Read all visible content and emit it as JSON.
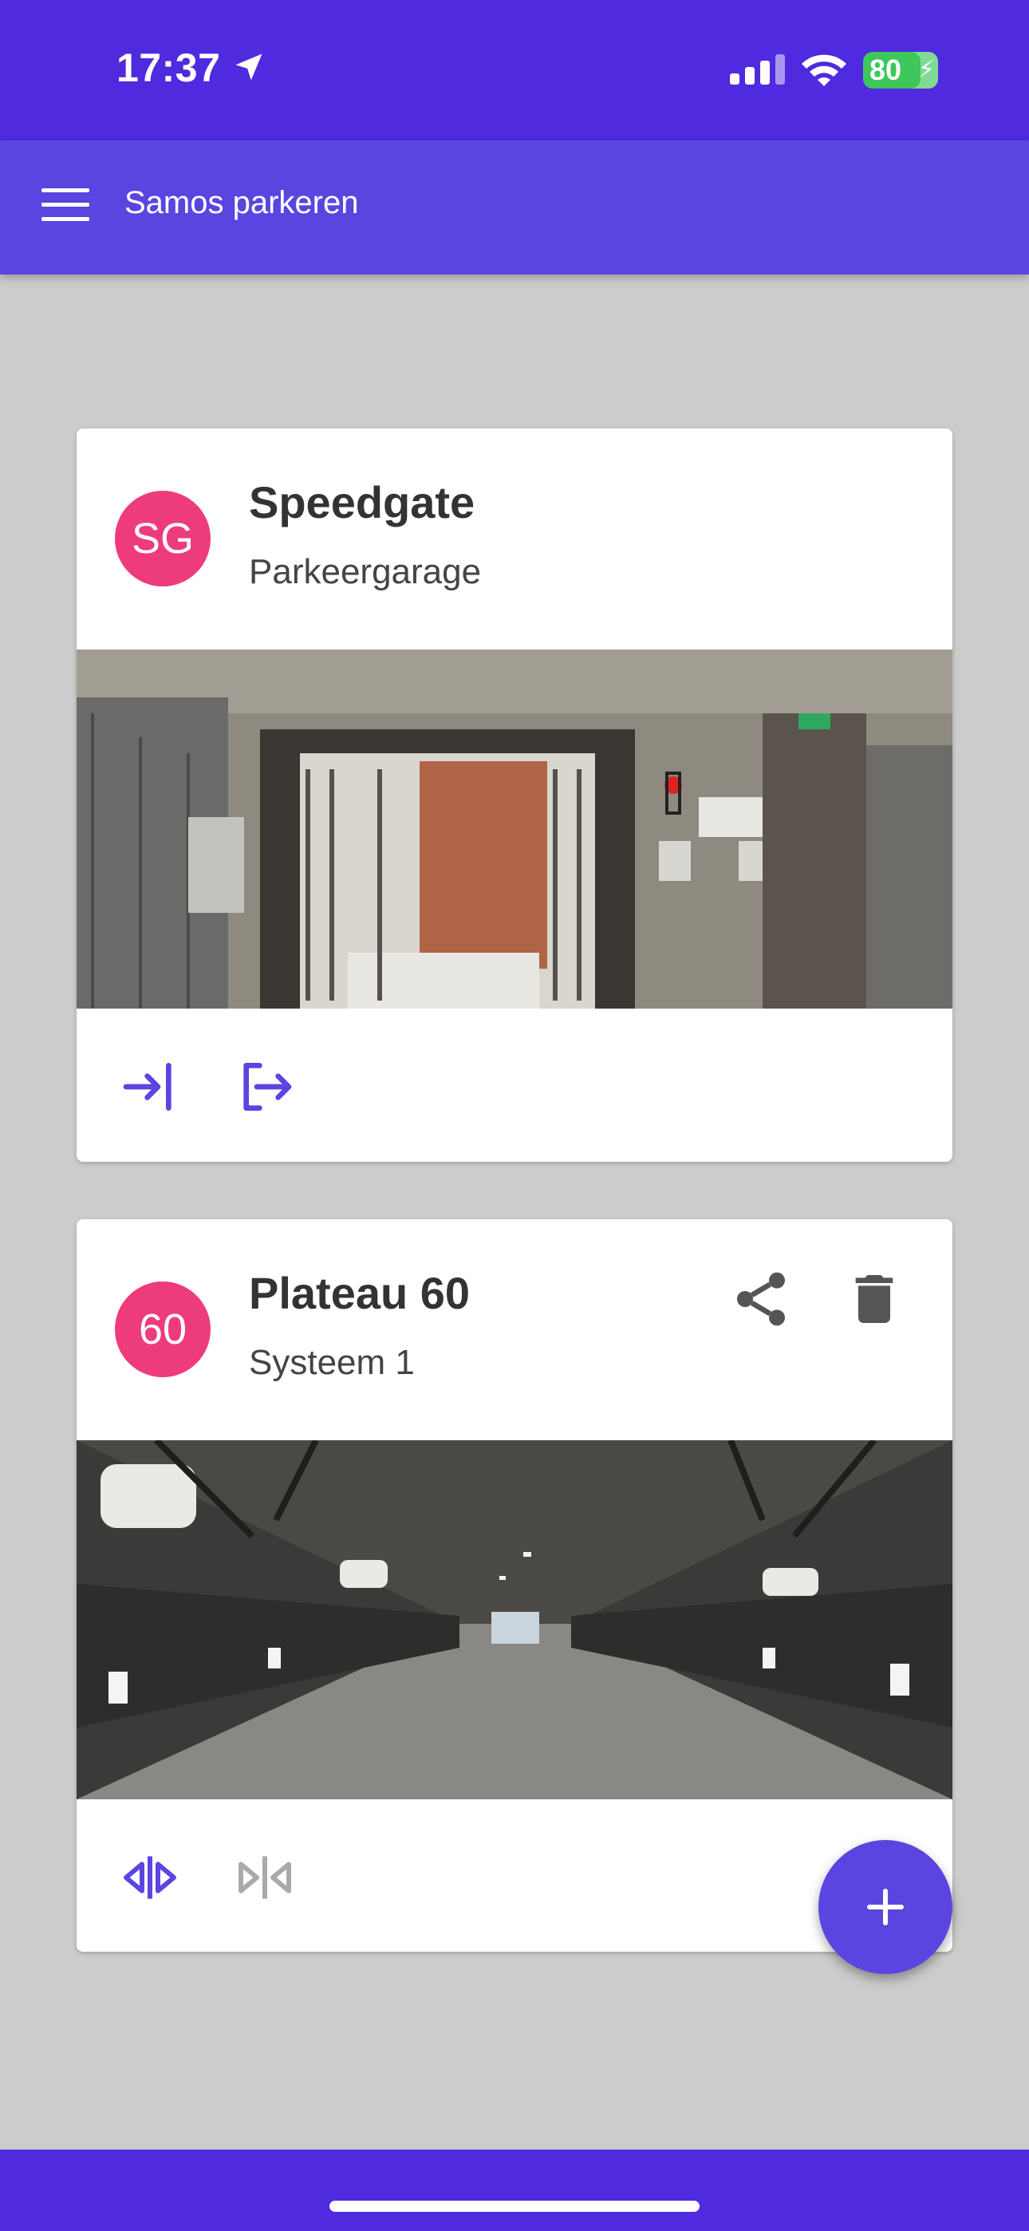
{
  "status_bar": {
    "time": "17:37",
    "battery": "80",
    "icons": [
      "location-arrow-icon",
      "cellular-signal-icon",
      "wifi-icon",
      "battery-charging-icon"
    ]
  },
  "app_bar": {
    "title": "Samos parkeren",
    "menu_icon": "hamburger-menu-icon",
    "color": "#5a45e0"
  },
  "cards": [
    {
      "avatar": "SG",
      "title": "Speedgate",
      "subtitle": "Parkeergarage",
      "image": "parking-garage-gate-photo",
      "actions": [
        "login-icon",
        "logout-icon"
      ]
    },
    {
      "avatar": "60",
      "title": "Plateau 60",
      "subtitle": "Systeem 1",
      "image": "parking-system-corridor-photo",
      "header_actions": [
        "share-icon",
        "delete-icon"
      ],
      "actions": [
        "open-gate-icon",
        "close-gate-icon"
      ]
    }
  ],
  "fab": {
    "icon": "plus-icon"
  },
  "colors": {
    "status_bar": "#4f2ade",
    "avatar": "#ee3b7c",
    "accent": "#5a45e0",
    "background": "#cccccc"
  }
}
